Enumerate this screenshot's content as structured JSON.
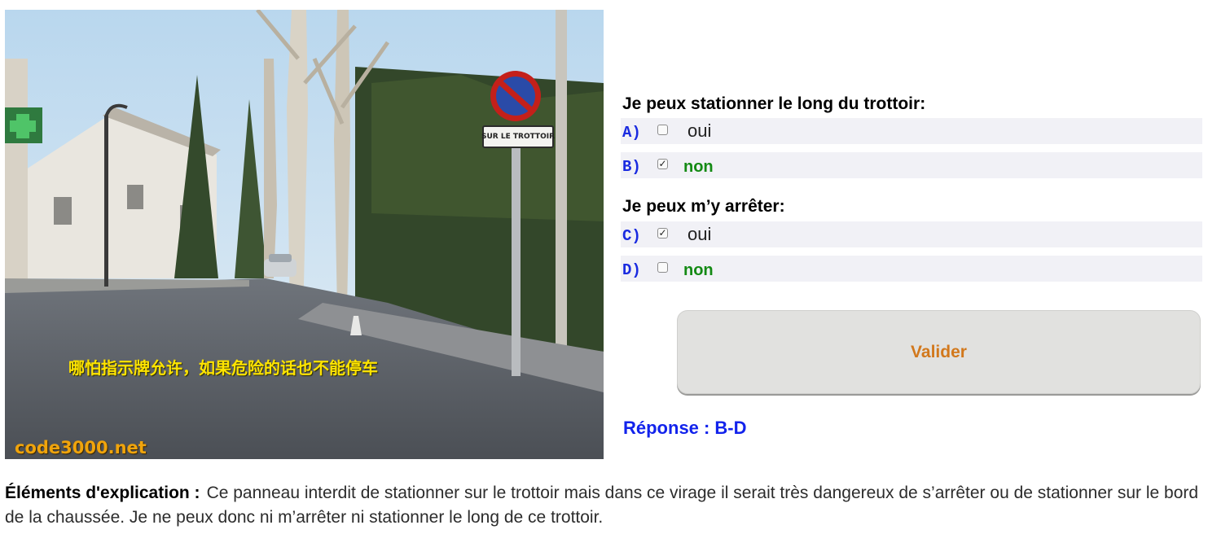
{
  "scene": {
    "sign_plate": "SUR LE TROTTOIR",
    "caption": "哪怕指示牌允许，如果危险的话也不能停车",
    "watermark": "code3000.net"
  },
  "questions": [
    {
      "title": "Je peux stationner le long du trottoir:",
      "options": [
        {
          "letter": "A)",
          "checked": false,
          "text": "oui"
        },
        {
          "letter": "B)",
          "checked": true,
          "text": "non"
        }
      ]
    },
    {
      "title": "Je peux m’y arrêter:",
      "options": [
        {
          "letter": "C)",
          "checked": true,
          "text": "oui"
        },
        {
          "letter": "D)",
          "checked": false,
          "text": "non"
        }
      ]
    }
  ],
  "validate_label": "Valider",
  "answer": {
    "label": "Réponse :",
    "value": "B-D"
  },
  "explanation": {
    "label": "Éléments d'explication :",
    "text": "Ce panneau interdit de stationner sur le trottoir mais dans ce virage il serait très dangereux de s’arrêter ou de stationner sur le bord de la chaussée. Je ne peux donc ni m’arrêter ni stationner le long de ce trottoir."
  },
  "colors": {
    "option_letter": "#1a2be0",
    "non_text": "#148a14",
    "validate_text": "#d2781c",
    "answer_text": "#1223ec",
    "caption_text": "#ffe400",
    "watermark_text": "#f0a40c"
  }
}
